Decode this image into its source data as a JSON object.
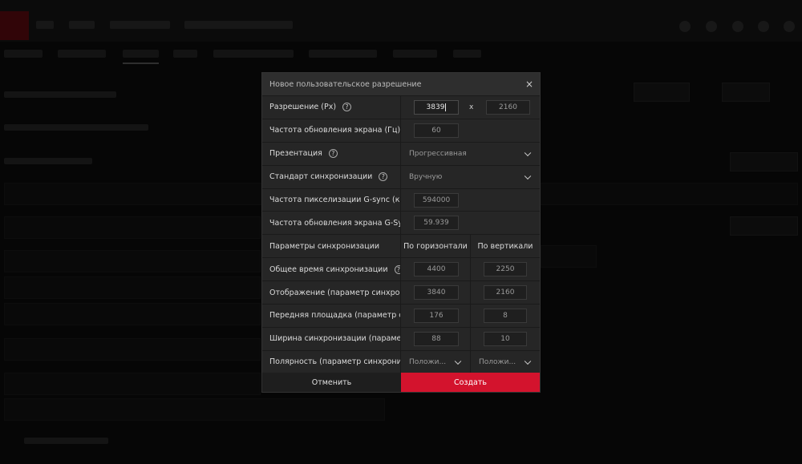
{
  "dialog": {
    "title": "Новое пользовательское разрешение",
    "close_label": "×",
    "resolution": {
      "label": "Разрешение (Px)",
      "width": "3839",
      "separator": "x",
      "height": "2160"
    },
    "refresh_rate": {
      "label": "Частота обновления экрана (Гц)",
      "value": "60"
    },
    "presentation": {
      "label": "Презентация",
      "value": "Прогрессивная"
    },
    "timing_standard": {
      "label": "Стандарт синхронизации",
      "value": "Вручную"
    },
    "pixel_clock": {
      "label": "Частота пикселизации G-sync (кГц)",
      "value": "594000"
    },
    "gsync_refresh": {
      "label": "Частота обновления экрана G-Sync (Гц)",
      "value": "59.939"
    },
    "timing_params": {
      "label": "Параметры синхронизации",
      "horizontal": "По горизонтали",
      "vertical": "По вертикали"
    },
    "total_timing": {
      "label": "Общее время синхронизации",
      "h": "4400",
      "v": "2250"
    },
    "display": {
      "label": "Отображение (параметр синхронизации)",
      "h": "3840",
      "v": "2160"
    },
    "front_porch": {
      "label": "Передняя площадка (параметр синхронизации)",
      "h": "176",
      "v": "8"
    },
    "sync_width": {
      "label": "Ширина синхронизации (параметр синхронизации)",
      "h": "88",
      "v": "10"
    },
    "polarity": {
      "label": "Полярность (параметр синхронизации)",
      "h": "Положи...",
      "v": "Положи..."
    },
    "help_glyph": "?",
    "cancel_label": "Отменить",
    "create_label": "Создать"
  },
  "colors": {
    "accent": "#d3132d",
    "dialog_bg": "#262626",
    "header_bg": "#2e2e2e"
  },
  "icons": {
    "close": "close-icon",
    "help": "help-icon",
    "dropdown": "chevron-down-icon"
  }
}
